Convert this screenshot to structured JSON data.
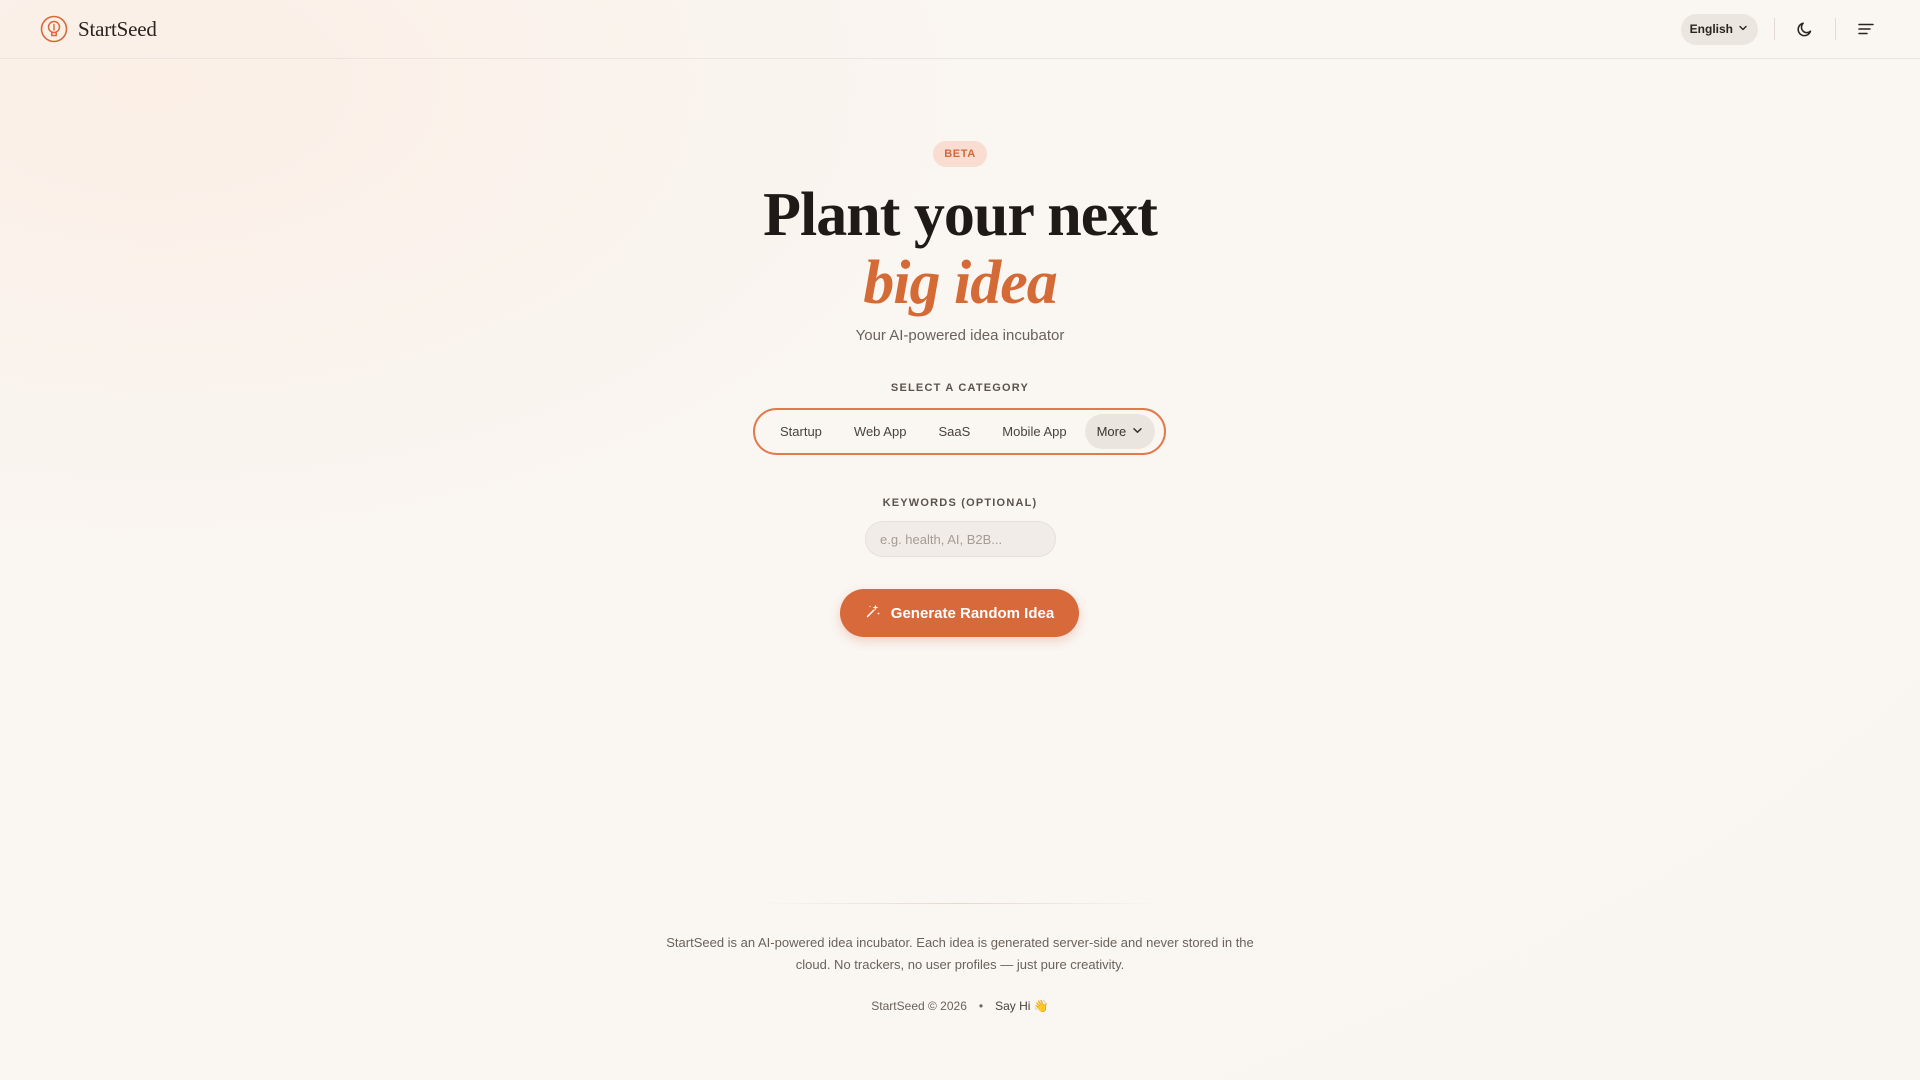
{
  "header": {
    "brand": "StartSeed",
    "language": "English",
    "icons": {
      "logo": "lightbulb-logo-icon",
      "language_caret": "chevron-down-icon",
      "theme": "moon-icon",
      "menu": "menu-icon"
    }
  },
  "hero": {
    "badge": "BETA",
    "title_line1": "Plant your next",
    "title_line2": "big idea",
    "subtitle": "Your AI-powered idea incubator"
  },
  "category": {
    "label": "SELECT A CATEGORY",
    "items": [
      "Startup",
      "Web App",
      "SaaS",
      "Mobile App"
    ],
    "more_label": "More"
  },
  "keywords": {
    "label": "KEYWORDS (OPTIONAL)",
    "value": "",
    "placeholder": "e.g. health, AI, B2B..."
  },
  "generate_button": {
    "label": "Generate Random Idea",
    "icon": "sparkles-icon"
  },
  "footer": {
    "description": "StartSeed is an AI-powered idea incubator. Each idea is generated server-side and never stored in the cloud. No trackers, no user profiles — just pure creativity.",
    "copyright": "StartSeed © 2026",
    "separator": "•",
    "say_hi": "Say Hi 👋"
  },
  "colors": {
    "accent": "#d8693a",
    "accent_text": "#d46a35",
    "badge_bg": "#f8ddd0",
    "background": "#faf6f2",
    "text": "#1f1a17"
  }
}
